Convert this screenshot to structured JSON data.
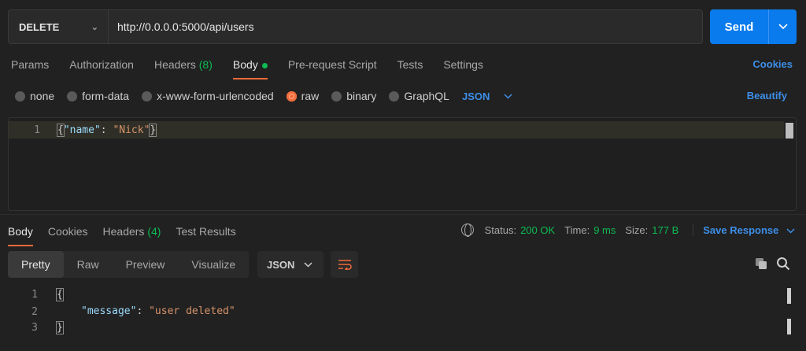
{
  "request": {
    "method": "DELETE",
    "url": "http://0.0.0.0:5000/api/users",
    "send_label": "Send"
  },
  "request_tabs": [
    {
      "label": "Params"
    },
    {
      "label": "Authorization"
    },
    {
      "label": "Headers",
      "count": "(8)"
    },
    {
      "label": "Body"
    },
    {
      "label": "Pre-request Script"
    },
    {
      "label": "Tests"
    },
    {
      "label": "Settings"
    }
  ],
  "cookies_label": "Cookies",
  "body_options": {
    "modes": [
      "none",
      "form-data",
      "x-www-form-urlencoded",
      "raw",
      "binary",
      "GraphQL"
    ],
    "selected": "raw",
    "format": "JSON",
    "beautify_label": "Beautify"
  },
  "request_body": {
    "line_number": "1",
    "open_brace": "{",
    "key": "\"name\"",
    "colon": ": ",
    "value": "\"Nick\"",
    "close_brace": "}"
  },
  "response_tabs": [
    {
      "label": "Body"
    },
    {
      "label": "Cookies"
    },
    {
      "label": "Headers",
      "count": "(4)"
    },
    {
      "label": "Test Results"
    }
  ],
  "response_meta": {
    "status_label": "Status:",
    "status_value": "200 OK",
    "time_label": "Time:",
    "time_value": "9 ms",
    "size_label": "Size:",
    "size_value": "177 B",
    "save_label": "Save Response"
  },
  "view_modes": [
    "Pretty",
    "Raw",
    "Preview",
    "Visualize"
  ],
  "response_format": "JSON",
  "response_body": {
    "line_numbers": [
      "1",
      "2",
      "3"
    ],
    "open_brace": "{",
    "key": "\"message\"",
    "colon": ": ",
    "value": "\"user deleted\"",
    "close_brace": "}"
  },
  "colors": {
    "accent": "#f26b3a",
    "send": "#097bed",
    "link": "#3d8fe8",
    "success": "#0cbb52"
  }
}
